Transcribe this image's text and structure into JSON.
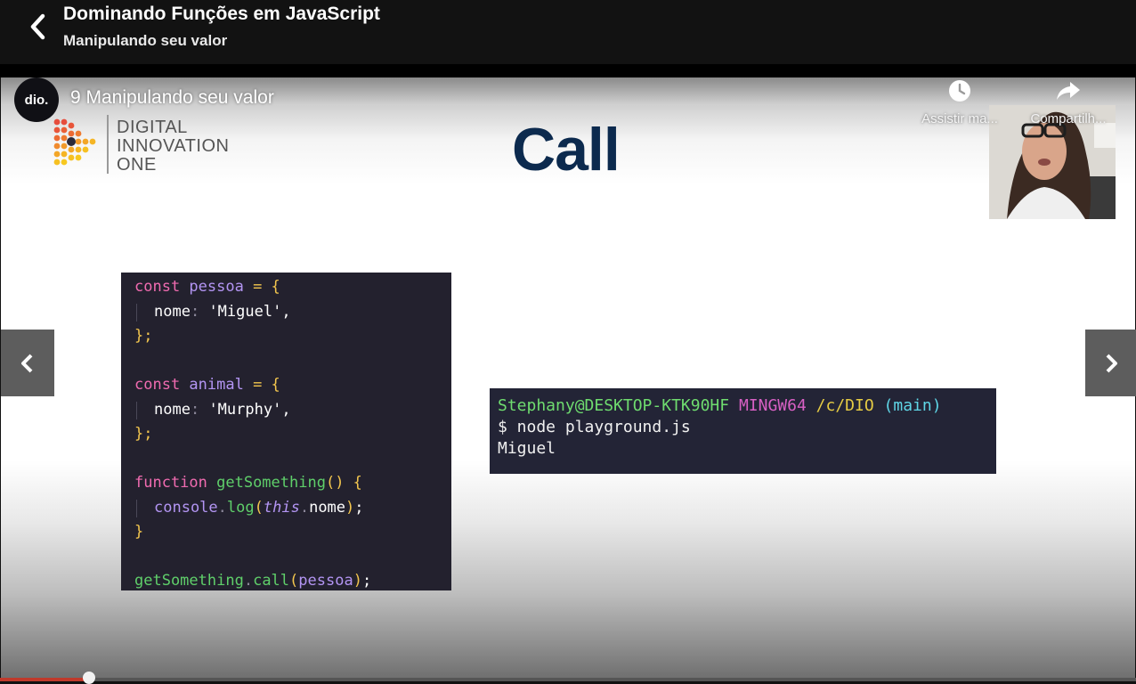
{
  "header": {
    "course_title": "Dominando Funções em JavaScript",
    "lesson_subtitle": "Manipulando seu valor"
  },
  "video": {
    "channel_avatar_text": "dio.",
    "title": "9 Manipulando seu valor",
    "watch_later_label": "Assistir ma...",
    "share_label": "Compartilh...",
    "progress_fraction": 0.078
  },
  "slide": {
    "logo_lines": [
      "DIGITAL",
      "INNOVATION",
      "ONE"
    ],
    "title": "Call",
    "code_lines": [
      [
        [
          "kw",
          "const "
        ],
        [
          "var",
          "pessoa "
        ],
        [
          "pun",
          "= {"
        ]
      ],
      [
        [
          "prop",
          "nome"
        ],
        [
          "sep",
          ": "
        ],
        [
          "str",
          "'Miguel'"
        ],
        [
          "prop",
          ","
        ]
      ],
      [
        [
          "pun",
          "};"
        ]
      ],
      [],
      [
        [
          "kw",
          "const "
        ],
        [
          "var",
          "animal "
        ],
        [
          "pun",
          "= {"
        ]
      ],
      [
        [
          "prop",
          "nome"
        ],
        [
          "sep",
          ": "
        ],
        [
          "str",
          "'Murphy'"
        ],
        [
          "prop",
          ","
        ]
      ],
      [
        [
          "pun",
          "};"
        ]
      ],
      [],
      [
        [
          "kw",
          "function "
        ],
        [
          "fn",
          "getSomething"
        ],
        [
          "pun",
          "() {"
        ]
      ],
      [
        [
          "obj",
          "console"
        ],
        [
          "sep",
          "."
        ],
        [
          "fn",
          "log"
        ],
        [
          "pun",
          "("
        ],
        [
          "this",
          "this"
        ],
        [
          "sep",
          "."
        ],
        [
          "prop",
          "nome"
        ],
        [
          "pun",
          ")"
        ],
        [
          "prop",
          ";"
        ]
      ],
      [
        [
          "pun",
          "}"
        ]
      ],
      [],
      [
        [
          "fn",
          "getSomething"
        ],
        [
          "sep",
          "."
        ],
        [
          "fn",
          "call"
        ],
        [
          "pun",
          "("
        ],
        [
          "var",
          "pessoa"
        ],
        [
          "pun",
          ")"
        ],
        [
          "prop",
          ";"
        ]
      ]
    ],
    "code_indented": [
      1,
      5,
      9
    ],
    "terminal": {
      "user": "Stephany@DESKTOP-KTK90HF",
      "system": "MINGW64",
      "path": "/c/DIO",
      "branch": "(main)",
      "command": "$ node playground.js",
      "output": "Miguel"
    }
  },
  "icons": {
    "back": "chevron-left-icon",
    "prev": "chevron-left-icon",
    "next": "chevron-right-icon",
    "watch_later": "clock-icon",
    "share": "share-arrow-icon"
  }
}
